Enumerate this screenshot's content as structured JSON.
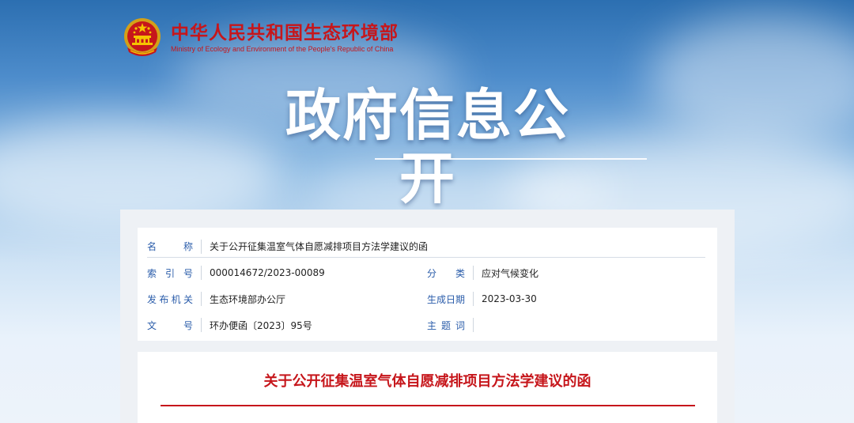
{
  "header": {
    "org_name_cn": "中华人民共和国生态环境部",
    "org_name_en": "Ministry of Ecology and Environment of the People's Republic of China",
    "emblem_icon": "national-emblem-icon"
  },
  "page_title": "政府信息公开",
  "meta": {
    "name_label": "名　　称",
    "name_value": "关于公开征集温室气体自愿减排项目方法学建议的函",
    "index_label": "索 引 号",
    "index_value": "000014672/2023-00089",
    "category_label": "分　　类",
    "category_value": "应对气候变化",
    "publisher_label": "发布机关",
    "publisher_value": "生态环境部办公厅",
    "date_label": "生成日期",
    "date_value": "2023-03-30",
    "doc_no_label": "文　　号",
    "doc_no_value": "环办便函〔2023〕95号",
    "subject_label": "主 题 词",
    "subject_value": ""
  },
  "document": {
    "title": "关于公开征集温室气体自愿减排项目方法学建议的函"
  },
  "colors": {
    "brand_red": "#c6161b",
    "label_blue": "#2a5caa"
  }
}
